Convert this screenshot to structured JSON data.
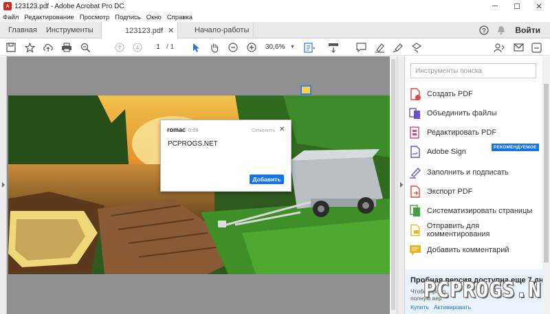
{
  "window": {
    "title": "123123.pdf - Adobe Acrobat Pro DC",
    "minimize": "─",
    "maximize": "☐",
    "close": "✕"
  },
  "menu": [
    "Файл",
    "Редактирование",
    "Просмотр",
    "Подпись",
    "Окно",
    "Справка"
  ],
  "tabs": {
    "home": "Главная",
    "tools": "Инструменты",
    "doc": "123123.pdf",
    "start": "Начало-работы",
    "doc_close": "✕"
  },
  "header": {
    "help": "?",
    "signin": "Войти"
  },
  "toolbar": {
    "page_current": "1",
    "page_total": "/ 1",
    "zoom": "30,6%"
  },
  "comment": {
    "author": "romac",
    "time": "0:09",
    "cancel": "Отменить",
    "close": "✕",
    "text": "PCPROGS.NET",
    "add_button": "Добавить"
  },
  "tools_panel": {
    "search_placeholder": "Инструменты поиска",
    "items": [
      {
        "label": "Создать PDF",
        "color": "#e0463c"
      },
      {
        "label": "Объединить файлы",
        "color": "#6b4fc7"
      },
      {
        "label": "Редактировать PDF",
        "color": "#d6457a"
      },
      {
        "label": "Adobe Sign",
        "color": "#6b4fc7"
      },
      {
        "label": "Заполнить и подписать",
        "color": "#6b4fc7"
      },
      {
        "label": "Экспорт PDF",
        "color": "#e0463c"
      },
      {
        "label": "Систематизировать страницы",
        "color": "#3f9e3f"
      },
      {
        "label": "Отправить для комментирования",
        "color": "#e8b620"
      },
      {
        "label": "Добавить комментарий",
        "color": "#e8b620"
      }
    ],
    "badge": "РЕКОМЕНДУЕМОЕ"
  },
  "trial": {
    "title": "Пробная версия доступна еще 7 дн.",
    "text1": "Чтобы продо",
    "text2": "полную вер",
    "buy": "Купить",
    "activate": "Активировать"
  },
  "watermark": "PCPROGS.NET"
}
